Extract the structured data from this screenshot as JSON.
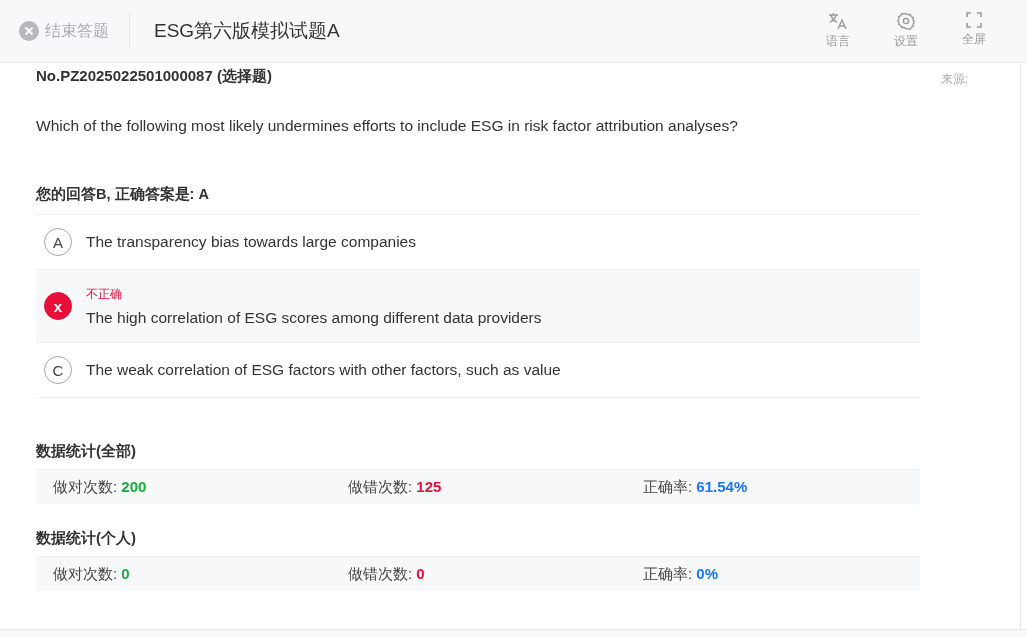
{
  "header": {
    "exit_label": "结束答题",
    "title": "ESG第六版模拟试题A",
    "tools": [
      {
        "kind": "language",
        "label": "语言"
      },
      {
        "kind": "settings",
        "label": "设置"
      },
      {
        "kind": "fullscreen",
        "label": "全屏"
      }
    ]
  },
  "question": {
    "number": "No.PZ2025022501000087 (选择题)",
    "source": "来源:",
    "text": "Which of the following most likely undermines efforts to include ESG in risk factor attribution analyses?",
    "answer_summary": "您的回答B, 正确答案是: A",
    "options": [
      {
        "marker": "A",
        "selected": false,
        "text": "The transparency bias towards large companies"
      },
      {
        "marker": "x",
        "selected": true,
        "feedback": "不正确",
        "text": "The high correlation of ESG scores among different data providers"
      },
      {
        "marker": "C",
        "selected": false,
        "text": "The weak correlation of ESG factors with other factors, such as value"
      }
    ]
  },
  "stats": [
    {
      "title": "数据统计(全部)",
      "items": [
        {
          "kind": "correct",
          "label": "做对次数: ",
          "value": "200"
        },
        {
          "kind": "wrong",
          "label": "做错次数: ",
          "value": "125"
        },
        {
          "kind": "rate",
          "label": "正确率: ",
          "value": "61.54%"
        }
      ]
    },
    {
      "title": "数据统计(个人)",
      "items": [
        {
          "kind": "correct",
          "label": "做对次数: ",
          "value": "0"
        },
        {
          "kind": "wrong",
          "label": "做错次数: ",
          "value": "0"
        },
        {
          "kind": "rate",
          "label": "正确率: ",
          "value": "0%"
        }
      ]
    }
  ]
}
